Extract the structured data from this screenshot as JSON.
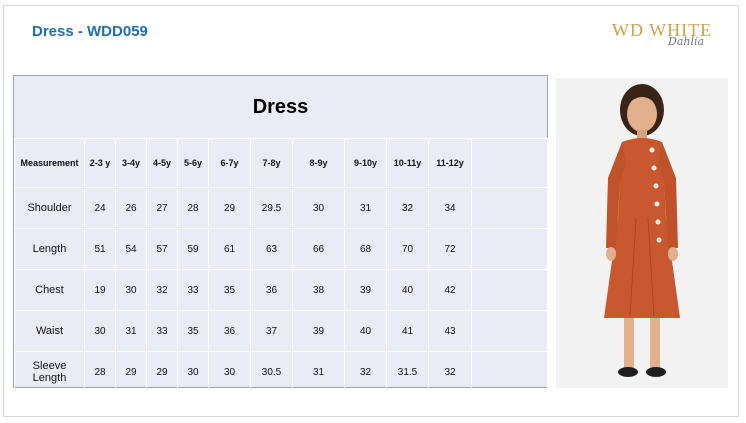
{
  "title": "Dress - WDD059",
  "brand": {
    "logo_main": "WD WHITE",
    "logo_script": "Dahlia"
  },
  "table": {
    "heading": "Dress",
    "header_label": "Measurement",
    "sizes": [
      "2-3 y",
      "3-4y",
      "4-5y",
      "5-6y",
      "6-7y",
      "7-8y",
      "8-9y",
      "9-10y",
      "10-11y",
      "11-12y",
      ""
    ],
    "rows": [
      {
        "label": "Shoulder",
        "values": [
          "24",
          "26",
          "27",
          "28",
          "29",
          "29.5",
          "30",
          "31",
          "32",
          "34",
          ""
        ]
      },
      {
        "label": "Length",
        "values": [
          "51",
          "54",
          "57",
          "59",
          "61",
          "63",
          "66",
          "68",
          "70",
          "72",
          ""
        ]
      },
      {
        "label": "Chest",
        "values": [
          "19",
          "30",
          "32",
          "33",
          "35",
          "36",
          "38",
          "39",
          "40",
          "42",
          ""
        ]
      },
      {
        "label": "Waist",
        "values": [
          "30",
          "31",
          "33",
          "35",
          "36",
          "37",
          "39",
          "40",
          "41",
          "43",
          ""
        ]
      },
      {
        "label": "Sleeve Length",
        "values": [
          "28",
          "29",
          "29",
          "30",
          "30",
          "30.5",
          "31",
          "32",
          "31.5",
          "32",
          ""
        ]
      }
    ]
  },
  "colors": {
    "title": "#1f6fb0",
    "table_bg": "#e9ebf5",
    "dress": "#c9582e",
    "logo": "#c9a24a"
  }
}
